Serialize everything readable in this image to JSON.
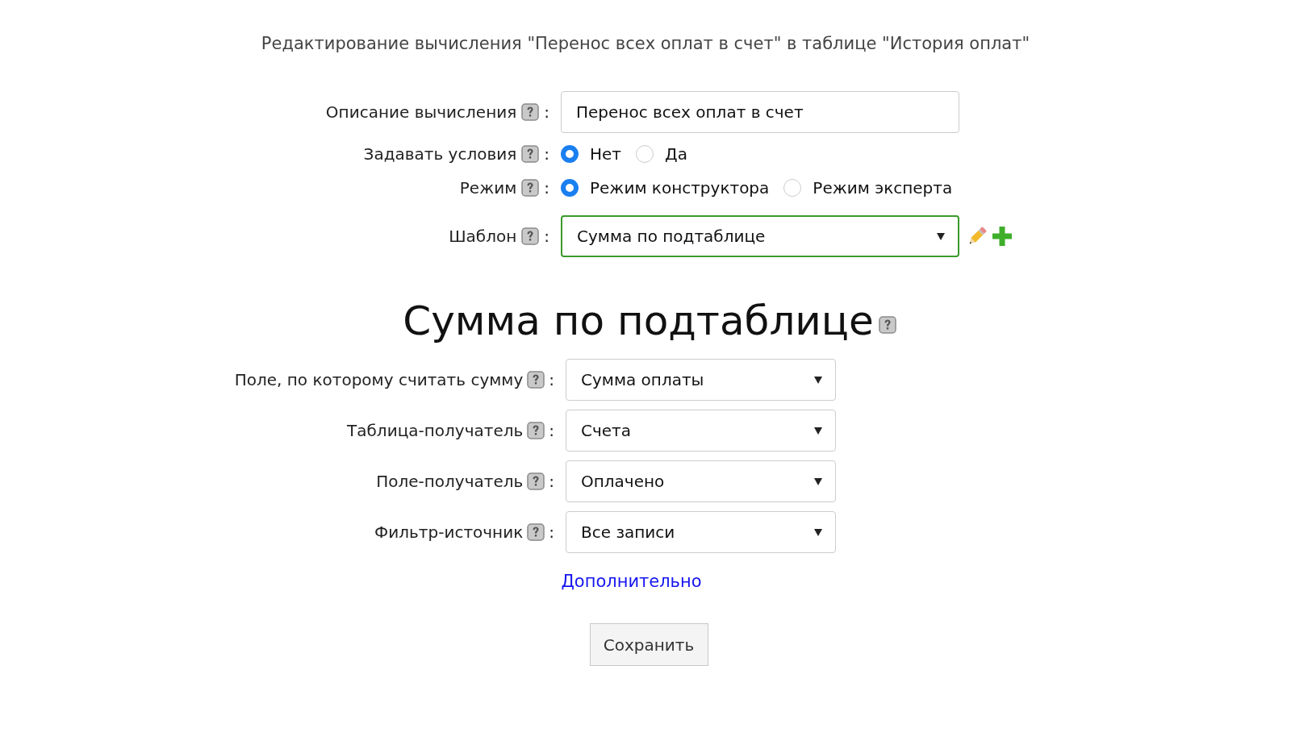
{
  "title": "Редактирование вычисления \"Перенос всех оплат в счет\" в таблице \"История оплат\"",
  "settings": [
    {
      "kind": "text",
      "label": "Описание вычисления",
      "separator": ":",
      "value": "Перенос всех оплат в счет"
    },
    {
      "kind": "radio",
      "label": "Задавать условия",
      "separator": ":",
      "options": [
        {
          "label": "Нет",
          "selected": true
        },
        {
          "label": "Да",
          "selected": false
        }
      ]
    },
    {
      "kind": "radio",
      "label": "Режим",
      "separator": ":",
      "options": [
        {
          "label": "Режим конструктора",
          "selected": true
        },
        {
          "label": "Режим эксперта",
          "selected": false
        }
      ]
    },
    {
      "kind": "select",
      "label": "Шаблон",
      "separator": ":",
      "value": "Сумма по подтаблице"
    }
  ],
  "section_title": "Сумма по подтаблице",
  "fields": [
    {
      "label": "Поле, по которому считать сумму",
      "separator": ":",
      "value": "Сумма оплаты"
    },
    {
      "label": "Таблица-получатель",
      "separator": ":",
      "value": "Счета"
    },
    {
      "label": "Поле-получатель",
      "separator": ":",
      "value": "Оплачено"
    },
    {
      "label": "Фильтр-источник",
      "separator": ":",
      "value": "Все записи"
    }
  ],
  "more_link": "Дополнительно",
  "save_button": "Сохранить"
}
